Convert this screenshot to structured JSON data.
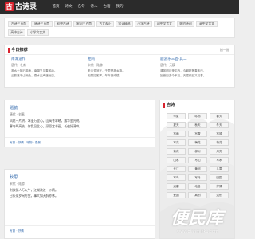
{
  "header": {
    "logo_mark": "古",
    "logo_text": "古诗录",
    "nav": [
      "首页",
      "诗文",
      "名句",
      "诗人",
      "古籍",
      "我的"
    ]
  },
  "tags": [
    "古诗三百首",
    "唐诗三百首",
    "初中古诗",
    "宋词三百首",
    "古文观止",
    "宋词精选",
    "小学古诗",
    "初中文言文",
    "婉约诗词",
    "高中文言文",
    "高中古诗",
    "小学文言文"
  ],
  "recommend": {
    "title": "今日推荐",
    "more": "换一批",
    "items": [
      {
        "title": "南湖遗作",
        "meta": "唐代 · 杜甫",
        "lines": [
          "湘水十年旧游地，南湖又见春风动。",
          "云影落千山深处，春水无声渡远空。"
        ]
      },
      {
        "title": "相鸟",
        "meta": "宋代 · 陆游",
        "lines": [
          "老去关河在，千里是故乡路。",
          "相思如客梦，年年到南楼。"
        ]
      },
      {
        "title": "题游乐三首·其二",
        "meta": "唐代 · 元稹",
        "lines": [
          "清风明月夜平西，今朝吟罢春未已，",
          "回首旧游今不见，天涯依旧又见春。"
        ]
      }
    ]
  },
  "poems": [
    {
      "title": "题韵",
      "meta": "唐代 · 刘禹",
      "lines": [
        "凤尾一片明，冰壶万里心。山高苍翠晓，露华金光明。",
        "寒鸟鸣高枝，你我见此心。深愿宜书画，长夜好清吟。"
      ],
      "tags": "写景 · 抒情 · 咏物 · 春景"
    },
    {
      "title": "秋思",
      "meta": "宋代 · 陆游",
      "lines": [
        "利欲驱人万火牛，江湖浪迹一沙鸥。",
        "日长似岁闲方觉，事大如天醉亦休。"
      ],
      "tags": "写景 · 抒情"
    }
  ],
  "side": {
    "title": "古诗",
    "chips": [
      "写景",
      "咏物",
      "春天",
      "夏天",
      "秋天",
      "冬天",
      "写雨",
      "写雪",
      "写风",
      "写花",
      "梅花",
      "荷花",
      "菊花",
      "柳树",
      "月亮",
      "山水",
      "写山",
      "写水",
      "长江",
      "黄河",
      "儿童",
      "写鸟",
      "写马",
      "田园",
      "边塞",
      "地名",
      "抒情",
      "爱国",
      "离别",
      "送别"
    ]
  },
  "watermark": {
    "text": "便民库",
    "url": "www.bianminku.com"
  }
}
